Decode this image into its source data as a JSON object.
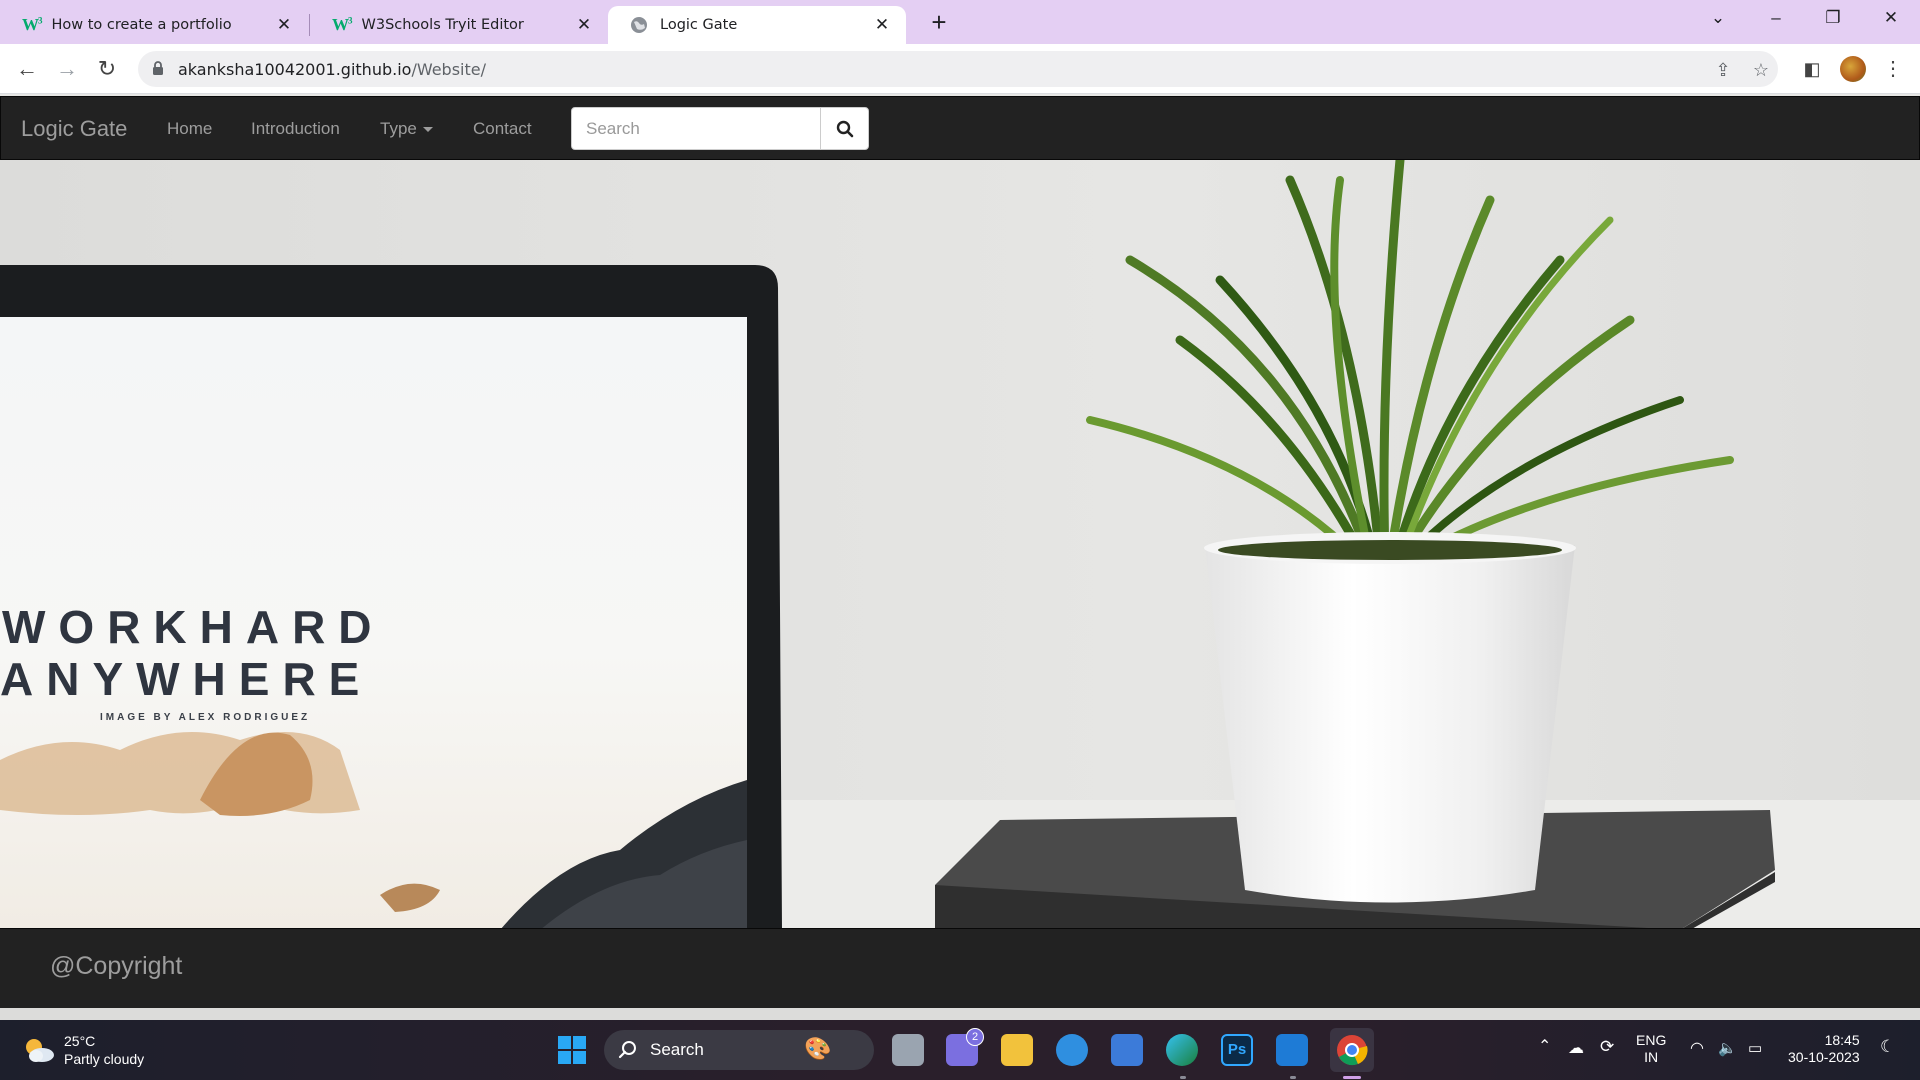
{
  "browser": {
    "tabs": [
      {
        "title": "How to create a portfolio",
        "favicon": "w3schools-icon"
      },
      {
        "title": "W3Schools Tryit Editor",
        "favicon": "w3schools-icon"
      },
      {
        "title": "Logic Gate",
        "favicon": "globe-icon",
        "active": true
      }
    ],
    "url_host": "akanksha10042001.github.io",
    "url_path": "/Website/"
  },
  "site": {
    "brand": "Logic Gate",
    "nav": [
      "Home",
      "Introduction",
      "Type",
      "Contact"
    ],
    "search_placeholder": "Search",
    "hero_text": {
      "line1": "WORKHARD",
      "line2": "ANYWHERE",
      "credit": "IMAGE BY ALEX RODRIGUEZ"
    },
    "footer": "@Copyright"
  },
  "taskbar": {
    "weather_temp": "25°C",
    "weather_desc": "Partly cloudy",
    "search_label": "Search",
    "chat_badge": "2",
    "lang1": "ENG",
    "lang2": "IN",
    "time": "18:45",
    "date": "30-10-2023"
  },
  "colors": {
    "tabstrip": "#e4cff3",
    "navbar": "#222222",
    "nav_text": "#9d9d9d",
    "taskbar": "#1f1f2b"
  }
}
